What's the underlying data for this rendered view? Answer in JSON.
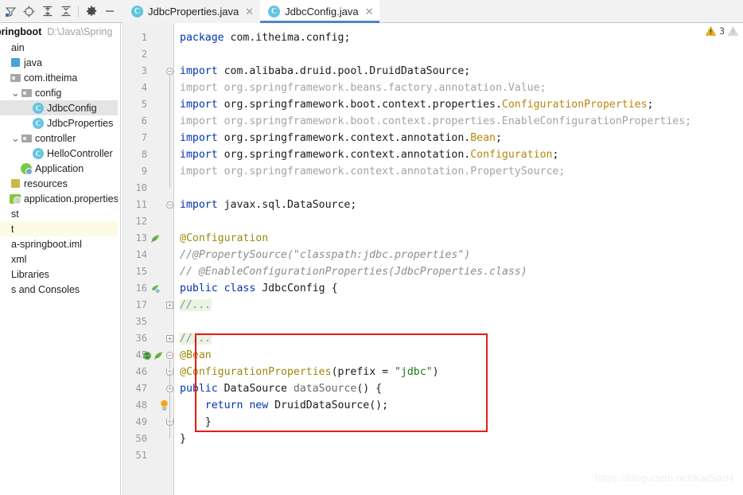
{
  "toolbar": {
    "icons": [
      {
        "name": "filter-icon",
        "label": "Filter"
      },
      {
        "name": "locate-icon",
        "label": "Select Opened File"
      },
      {
        "name": "expand-all-icon",
        "label": "Expand All"
      },
      {
        "name": "collapse-all-icon",
        "label": "Collapse All"
      },
      {
        "name": "gear-icon",
        "label": "Settings"
      },
      {
        "name": "minimize-icon",
        "label": "Hide"
      }
    ]
  },
  "tabs": [
    {
      "label": "JdbcProperties.java",
      "icon": "C",
      "active": false
    },
    {
      "label": "JdbcConfig.java",
      "icon": "C",
      "active": true
    }
  ],
  "sidebar": {
    "project_name": "pringboot",
    "project_path": "D:\\Java\\Spring",
    "items": [
      {
        "label": "ain",
        "icon": "none",
        "indent": 0,
        "chev": "",
        "state": "normal"
      },
      {
        "label": "java",
        "icon": "src",
        "indent": 0,
        "chev": "",
        "state": "normal"
      },
      {
        "label": "com.itheima",
        "icon": "folder",
        "indent": 1,
        "chev": "",
        "state": "normal"
      },
      {
        "label": "config",
        "icon": "folder",
        "indent": 2,
        "chev": "v",
        "state": "normal"
      },
      {
        "label": "JdbcConfig",
        "icon": "class",
        "indent": 3,
        "chev": "",
        "state": "selected"
      },
      {
        "label": "JdbcProperties",
        "icon": "class",
        "indent": 3,
        "chev": "",
        "state": "normal"
      },
      {
        "label": "controller",
        "icon": "folder",
        "indent": 2,
        "chev": "v",
        "state": "normal"
      },
      {
        "label": "HelloController",
        "icon": "class",
        "indent": 3,
        "chev": "",
        "state": "normal"
      },
      {
        "label": "Application",
        "icon": "spring",
        "indent": 2,
        "chev": "",
        "state": "normal"
      },
      {
        "label": "resources",
        "icon": "res",
        "indent": 0,
        "chev": "",
        "state": "normal"
      },
      {
        "label": "application.properties",
        "icon": "prop",
        "indent": 1,
        "chev": "",
        "state": "normal"
      },
      {
        "label": "st",
        "icon": "none",
        "indent": 0,
        "chev": "",
        "state": "normal"
      },
      {
        "label": "t",
        "icon": "none",
        "indent": 0,
        "chev": "",
        "state": "highlight"
      },
      {
        "label": "a-springboot.iml",
        "icon": "none",
        "indent": 0,
        "chev": "",
        "state": "normal"
      },
      {
        "label": "xml",
        "icon": "none",
        "indent": 0,
        "chev": "",
        "state": "normal"
      },
      {
        "label": "Libraries",
        "icon": "none",
        "indent": 0,
        "chev": "",
        "state": "normal"
      },
      {
        "label": "s and Consoles",
        "icon": "none",
        "indent": 0,
        "chev": "",
        "state": "normal"
      }
    ]
  },
  "editor": {
    "file": "JdbcConfig.java",
    "current_line": 48,
    "lines": [
      {
        "num": "1",
        "fold": "",
        "gmark": "",
        "hl": false,
        "foldhl": false,
        "tokens": [
          {
            "t": "package ",
            "c": "kw"
          },
          {
            "t": "com.itheima.config;",
            "c": "plain"
          }
        ]
      },
      {
        "num": "2",
        "fold": "",
        "gmark": "",
        "hl": false,
        "foldhl": false,
        "tokens": []
      },
      {
        "num": "3",
        "fold": "minus",
        "gmark": "",
        "hl": false,
        "foldhl": false,
        "tokens": [
          {
            "t": "import ",
            "c": "kw"
          },
          {
            "t": "com.alibaba.druid.pool.DruidDataSource;",
            "c": "plain"
          }
        ]
      },
      {
        "num": "4",
        "fold": "",
        "gmark": "",
        "hl": false,
        "foldhl": false,
        "tokens": [
          {
            "t": "import org.springframework.beans.factory.annotation.Value;",
            "c": "gray"
          }
        ]
      },
      {
        "num": "5",
        "fold": "",
        "gmark": "",
        "hl": false,
        "foldhl": false,
        "tokens": [
          {
            "t": "import ",
            "c": "kw"
          },
          {
            "t": "org.springframework.boot.context.properties.",
            "c": "plain"
          },
          {
            "t": "ConfigurationProperties",
            "c": "cls"
          },
          {
            "t": ";",
            "c": "plain"
          }
        ]
      },
      {
        "num": "6",
        "fold": "",
        "gmark": "",
        "hl": false,
        "foldhl": false,
        "tokens": [
          {
            "t": "import org.springframework.boot.context.properties.EnableConfigurationProperties;",
            "c": "gray"
          }
        ]
      },
      {
        "num": "7",
        "fold": "",
        "gmark": "",
        "hl": false,
        "foldhl": false,
        "tokens": [
          {
            "t": "import ",
            "c": "kw"
          },
          {
            "t": "org.springframework.context.annotation.",
            "c": "plain"
          },
          {
            "t": "Bean",
            "c": "cls"
          },
          {
            "t": ";",
            "c": "plain"
          }
        ]
      },
      {
        "num": "8",
        "fold": "",
        "gmark": "",
        "hl": false,
        "foldhl": false,
        "tokens": [
          {
            "t": "import ",
            "c": "kw"
          },
          {
            "t": "org.springframework.context.annotation.",
            "c": "plain"
          },
          {
            "t": "Configuration",
            "c": "cls"
          },
          {
            "t": ";",
            "c": "plain"
          }
        ]
      },
      {
        "num": "9",
        "fold": "",
        "gmark": "",
        "hl": false,
        "foldhl": false,
        "tokens": [
          {
            "t": "import org.springframework.context.annotation.PropertySource;",
            "c": "gray"
          }
        ]
      },
      {
        "num": "10",
        "fold": "",
        "gmark": "",
        "hl": false,
        "foldhl": false,
        "tokens": []
      },
      {
        "num": "11",
        "fold": "minus",
        "gmark": "",
        "hl": false,
        "foldhl": false,
        "tokens": [
          {
            "t": "import ",
            "c": "kw"
          },
          {
            "t": "javax.sql.DataSource;",
            "c": "plain"
          }
        ]
      },
      {
        "num": "12",
        "fold": "",
        "gmark": "",
        "hl": false,
        "foldhl": false,
        "tokens": []
      },
      {
        "num": "13",
        "fold": "",
        "gmark": "bean",
        "hl": false,
        "foldhl": false,
        "tokens": [
          {
            "t": "@Configuration",
            "c": "ann"
          }
        ]
      },
      {
        "num": "14",
        "fold": "",
        "gmark": "",
        "hl": false,
        "foldhl": false,
        "tokens": [
          {
            "t": "//@PropertySource(\"classpath:jdbc.properties\")",
            "c": "cmt"
          }
        ]
      },
      {
        "num": "15",
        "fold": "",
        "gmark": "",
        "hl": false,
        "foldhl": false,
        "tokens": [
          {
            "t": "// @EnableConfigurationProperties(JdbcProperties.class)",
            "c": "cmt"
          }
        ]
      },
      {
        "num": "16",
        "fold": "",
        "gmark": "config",
        "hl": false,
        "foldhl": false,
        "tokens": [
          {
            "t": "public ",
            "c": "kw"
          },
          {
            "t": "class ",
            "c": "kw"
          },
          {
            "t": "JdbcConfig",
            "c": "plain"
          },
          {
            "t": " {",
            "c": "plain"
          }
        ]
      },
      {
        "num": "17",
        "fold": "plus",
        "gmark": "",
        "hl": false,
        "foldhl": true,
        "tokens": [
          {
            "t": "//...",
            "c": "cmt"
          }
        ]
      },
      {
        "num": "35",
        "fold": "",
        "gmark": "",
        "hl": false,
        "foldhl": false,
        "tokens": []
      },
      {
        "num": "36",
        "fold": "plus",
        "gmark": "",
        "hl": false,
        "foldhl": true,
        "tokens": [
          {
            "t": "//...",
            "c": "cmt"
          }
        ]
      },
      {
        "num": "45",
        "fold": "minus",
        "gmark": "override-bean",
        "hl": false,
        "foldhl": false,
        "tokens": [
          {
            "t": "@Bean",
            "c": "ann"
          }
        ]
      },
      {
        "num": "46",
        "fold": "minus-sm",
        "gmark": "",
        "hl": false,
        "foldhl": false,
        "tokens": [
          {
            "t": "@ConfigurationProperties",
            "c": "ann"
          },
          {
            "t": "(",
            "c": "plain"
          },
          {
            "t": "prefix",
            "c": "plain"
          },
          {
            "t": " = ",
            "c": "plain"
          },
          {
            "t": "\"jdbc\"",
            "c": "str"
          },
          {
            "t": ")",
            "c": "plain"
          }
        ]
      },
      {
        "num": "47",
        "fold": "minus",
        "gmark": "",
        "hl": false,
        "foldhl": false,
        "tokens": [
          {
            "t": "public ",
            "c": "kw"
          },
          {
            "t": "DataSource ",
            "c": "plain"
          },
          {
            "t": "dataSource",
            "c": "mth"
          },
          {
            "t": "() {",
            "c": "plain"
          }
        ]
      },
      {
        "num": "48",
        "fold": "",
        "gmark": "bulb",
        "hl": true,
        "foldhl": false,
        "tokens": [
          {
            "t": "    ",
            "c": "plain"
          },
          {
            "t": "return ",
            "c": "kw"
          },
          {
            "t": "new ",
            "c": "kw"
          },
          {
            "t": "DruidDataSource();",
            "c": "plain"
          }
        ]
      },
      {
        "num": "49",
        "fold": "minus-sm",
        "gmark": "",
        "hl": false,
        "foldhl": false,
        "tokens": [
          {
            "t": "    }",
            "c": "plain"
          }
        ]
      },
      {
        "num": "50",
        "fold": "",
        "gmark": "",
        "hl": false,
        "foldhl": false,
        "tokens": [
          {
            "t": "}",
            "c": "plain"
          }
        ]
      },
      {
        "num": "51",
        "fold": "",
        "gmark": "",
        "hl": false,
        "foldhl": false,
        "tokens": []
      }
    ]
  },
  "inspection": {
    "warning_count": "3",
    "warning_color": "#e8b21c"
  },
  "annotation_box": {
    "color": "#e81c12",
    "note": "highlight around @Bean dataSource method"
  },
  "watermark": "https://blog.csdn.net/KaiSarH"
}
